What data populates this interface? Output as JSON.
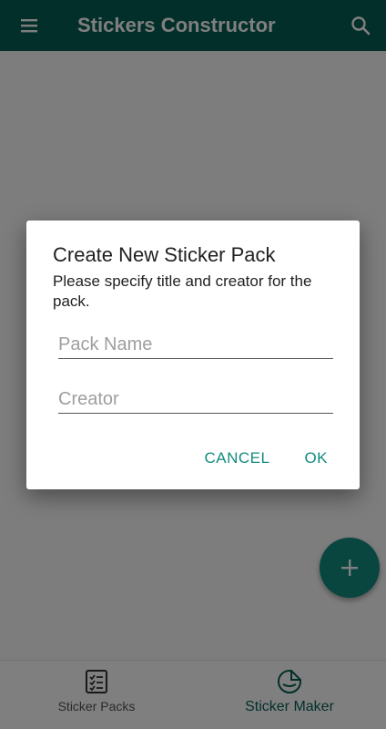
{
  "app_bar": {
    "title": "Stickers Constructor",
    "menu_icon": "menu-icon",
    "search_icon": "search-icon"
  },
  "fab": {
    "icon": "plus-icon"
  },
  "bottom_nav": {
    "items": [
      {
        "label": "Sticker Packs",
        "icon": "checklist-icon",
        "active": false
      },
      {
        "label": "Sticker Maker",
        "icon": "sticker-icon",
        "active": true
      }
    ]
  },
  "dialog": {
    "title": "Create New Sticker Pack",
    "message": "Please specify title and creator for the pack.",
    "pack_name_placeholder": "Pack Name",
    "pack_name_value": "",
    "creator_placeholder": "Creator",
    "creator_value": "",
    "cancel_label": "CANCEL",
    "ok_label": "OK"
  },
  "colors": {
    "primary": "#075e54",
    "accent": "#128c7e",
    "scrim": "rgba(0,0,0,0.5)"
  }
}
